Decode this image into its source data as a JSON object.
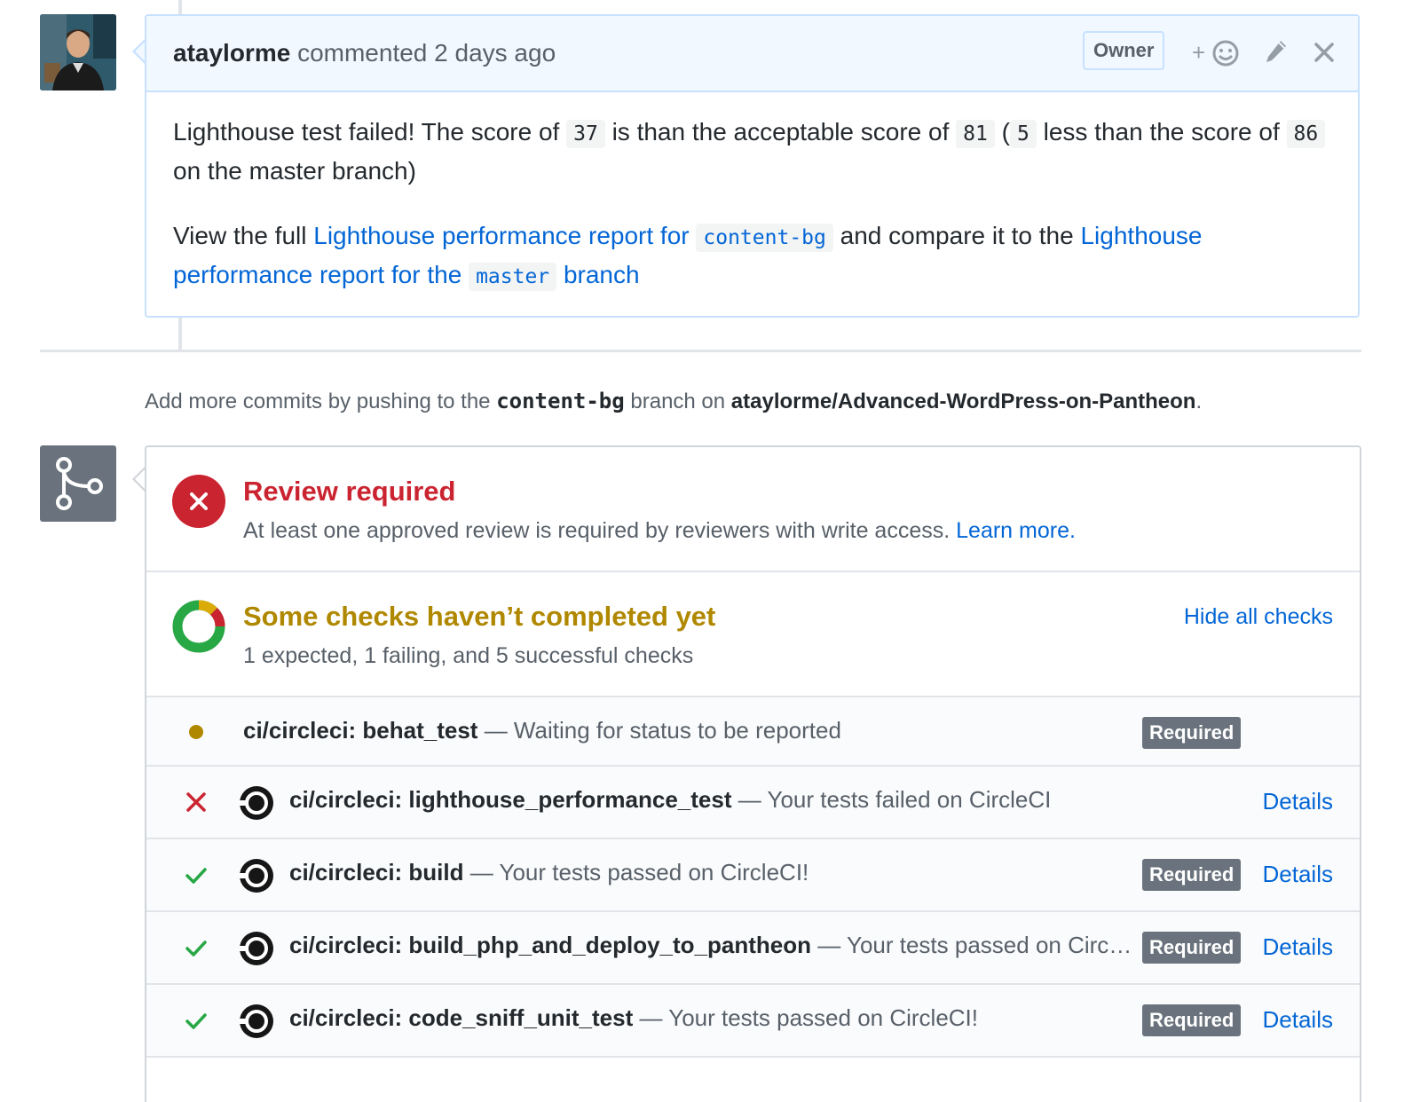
{
  "comment": {
    "author": "ataylorme",
    "action": "commented",
    "time": "2 days ago",
    "role_badge": "Owner",
    "add_reaction": "+",
    "body": {
      "p1": {
        "t1": "Lighthouse test failed! The score of",
        "score": "37",
        "t2": "is than the acceptable score of",
        "acceptable": "81",
        "t3": "(",
        "diff": "5",
        "t4": "less than the score of",
        "master_score": "86",
        "t5": "on the master branch)"
      },
      "p2": {
        "t1": "View the full",
        "link1_text": "Lighthouse performance report for",
        "link1_code": "content-bg",
        "t2": "and compare it to the",
        "link2_text": "Lighthouse performance report for the",
        "link2_code": "master",
        "link2_tail": "branch"
      }
    }
  },
  "push_note": {
    "t1": "Add more commits by pushing to the",
    "branch": "content-bg",
    "t2": "branch on",
    "repo": "ataylorme/Advanced-WordPress-on-Pantheon",
    "t3": "."
  },
  "merge": {
    "review": {
      "title": "Review required",
      "desc": "At least one approved review is required by reviewers with write access.",
      "learn_more": "Learn more."
    },
    "checks": {
      "title": "Some checks haven’t completed yet",
      "desc": "1 expected, 1 failing, and 5 successful checks",
      "hide_all": "Hide all checks",
      "items": [
        {
          "name": "ci/circleci: behat_test",
          "desc": "— Waiting for status to be reported",
          "state": "pending",
          "required": "Required",
          "details": ""
        },
        {
          "name": "ci/circleci: lighthouse_performance_test",
          "desc": "— Your tests failed on CircleCI",
          "state": "failure",
          "required": "",
          "details": "Details"
        },
        {
          "name": "ci/circleci: build",
          "desc": "— Your tests passed on CircleCI!",
          "state": "success",
          "required": "Required",
          "details": "Details"
        },
        {
          "name": "ci/circleci: build_php_and_deploy_to_pantheon",
          "desc": "— Your tests passed on CircleCI!",
          "state": "success",
          "required": "Required",
          "details": "Details"
        },
        {
          "name": "ci/circleci: code_sniff_unit_test",
          "desc": "— Your tests passed on CircleCI!",
          "state": "success",
          "required": "Required",
          "details": "Details"
        }
      ]
    }
  },
  "colors": {
    "failure": "#cb2431",
    "pending": "#b08800",
    "success": "#28a745",
    "link": "#0366d6"
  }
}
